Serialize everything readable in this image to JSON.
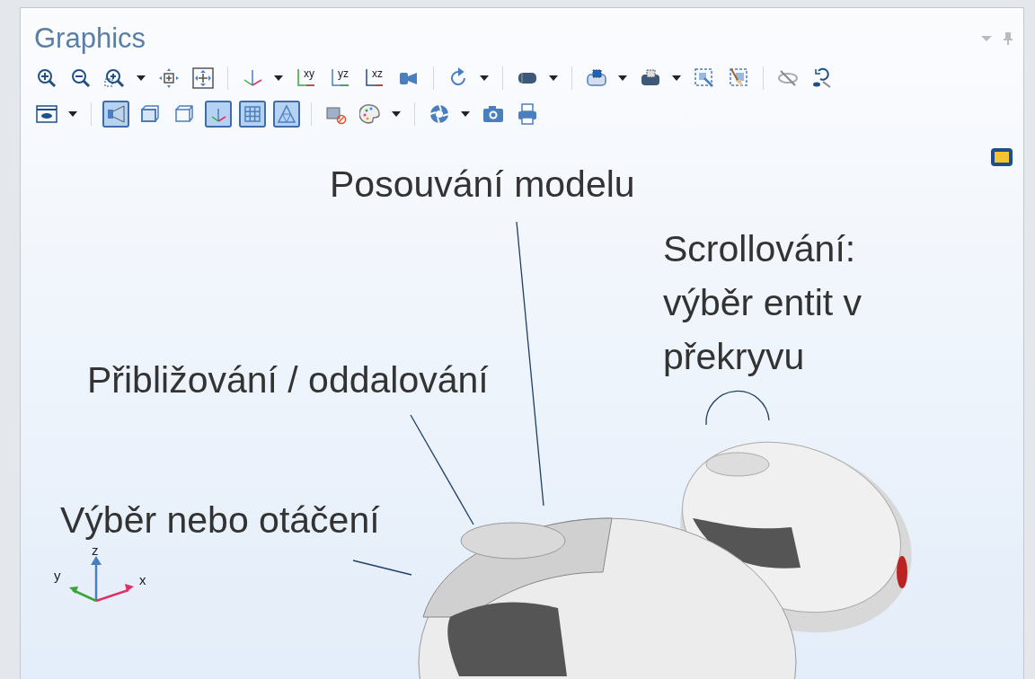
{
  "panel": {
    "title": "Graphics"
  },
  "toolbar": [
    [
      {
        "kind": "tool",
        "selected": false
      },
      {
        "kind": "tool",
        "selected": false
      },
      {
        "kind": "tool",
        "selected": false
      },
      {
        "kind": "menu"
      },
      {
        "kind": "tool",
        "selected": false
      },
      {
        "kind": "tool",
        "selected": false
      },
      {
        "kind": "separator"
      },
      {
        "kind": "tool",
        "selected": false
      },
      {
        "kind": "menu"
      },
      {
        "kind": "tool",
        "selected": false,
        "label": "xy"
      },
      {
        "kind": "tool",
        "selected": false,
        "label": "yz"
      },
      {
        "kind": "tool",
        "selected": false,
        "label": "xz"
      },
      {
        "kind": "tool",
        "selected": false
      },
      {
        "kind": "separator"
      },
      {
        "kind": "tool",
        "selected": false
      },
      {
        "kind": "menu"
      },
      {
        "kind": "separator"
      },
      {
        "kind": "tool",
        "selected": false
      },
      {
        "kind": "menu"
      },
      {
        "kind": "separator"
      },
      {
        "kind": "tool",
        "selected": false
      },
      {
        "kind": "menu"
      },
      {
        "kind": "tool",
        "selected": false
      },
      {
        "kind": "menu"
      },
      {
        "kind": "tool",
        "selected": false
      },
      {
        "kind": "tool",
        "selected": false
      },
      {
        "kind": "separator"
      },
      {
        "kind": "tool",
        "selected": false
      },
      {
        "kind": "tool",
        "selected": false
      }
    ],
    [
      {
        "kind": "tool",
        "selected": false
      },
      {
        "kind": "menu"
      },
      {
        "kind": "separator"
      },
      {
        "kind": "tool",
        "selected": true
      },
      {
        "kind": "tool",
        "selected": false
      },
      {
        "kind": "tool",
        "selected": false
      },
      {
        "kind": "tool",
        "selected": true
      },
      {
        "kind": "tool",
        "selected": true
      },
      {
        "kind": "tool",
        "selected": true
      },
      {
        "kind": "separator"
      },
      {
        "kind": "tool",
        "selected": false
      },
      {
        "kind": "tool",
        "selected": false
      },
      {
        "kind": "menu"
      },
      {
        "kind": "separator"
      },
      {
        "kind": "tool",
        "selected": false
      },
      {
        "kind": "menu"
      },
      {
        "kind": "tool",
        "selected": false
      },
      {
        "kind": "tool",
        "selected": false
      }
    ]
  ],
  "annotations": [
    {
      "text": "Posouvání modelu"
    },
    {
      "text": "Scrollování:\nvýběr entit v\npřekryvu"
    },
    {
      "text": "Přibližování / oddalování"
    },
    {
      "text": "Výběr nebo otáčení"
    }
  ],
  "axis_triad": {
    "x": "x",
    "y": "y",
    "z": "z"
  }
}
